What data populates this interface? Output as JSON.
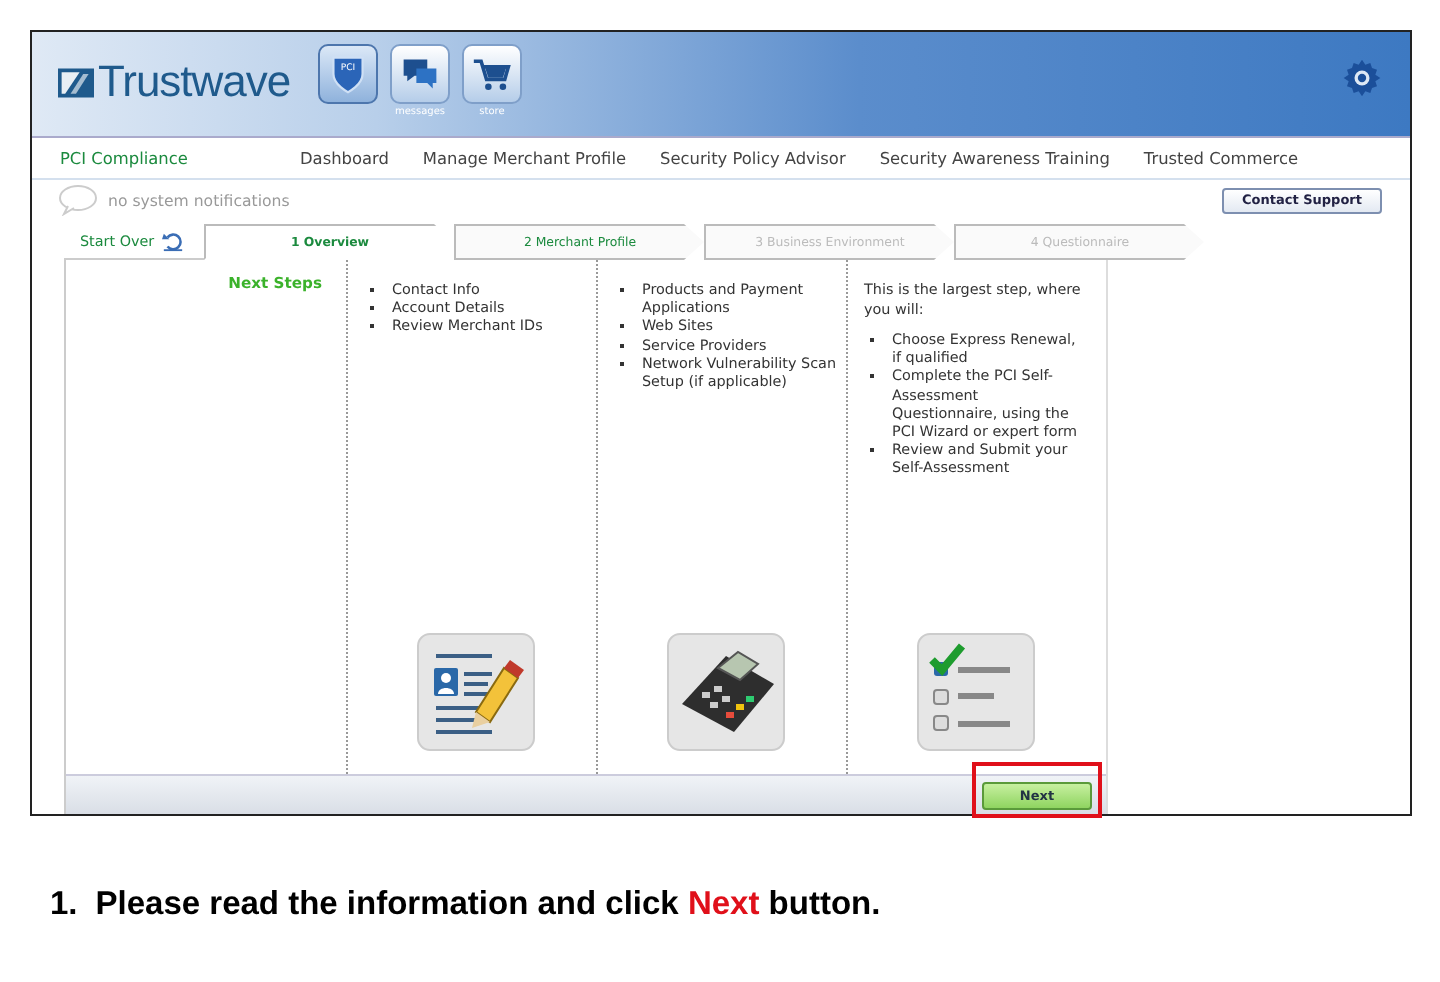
{
  "header": {
    "logo": "Trustwave",
    "apps": [
      {
        "kind": "pci",
        "badge": "PCI",
        "selected": true
      },
      {
        "kind": "messages",
        "label": "messages",
        "selected": false
      },
      {
        "kind": "store",
        "label": "store",
        "selected": false
      }
    ]
  },
  "nav": {
    "section": "PCI Compliance",
    "items": [
      "Dashboard",
      "Manage Merchant Profile",
      "Security Policy Advisor",
      "Security Awareness Training",
      "Trusted Commerce"
    ]
  },
  "notifications": "no system notifications",
  "contact_button": "Contact Support",
  "steps": {
    "start_over": "Start Over",
    "items": [
      {
        "label": "1 Overview",
        "selected": true,
        "disabled": false
      },
      {
        "label": "2 Merchant Profile",
        "selected": false,
        "disabled": false
      },
      {
        "label": "3 Business Environment",
        "selected": false,
        "disabled": true
      },
      {
        "label": "4 Questionnaire",
        "selected": false,
        "disabled": true
      }
    ]
  },
  "next_steps_title": "Next Steps",
  "columns": [
    {
      "kind": "profile",
      "items": [
        "Contact Info",
        "Account Details",
        "Review Merchant IDs"
      ]
    },
    {
      "kind": "terminal",
      "items": [
        "Products and Payment Applications",
        "Web Sites",
        "Service Providers",
        "Network Vulnerability Scan Setup (if applicable)"
      ]
    },
    {
      "kind": "checklist",
      "intro": "This is the largest step, where you will:",
      "items": [
        "Choose Express Renewal, if qualified",
        "Complete the PCI Self-Assessment Questionnaire, using the PCI Wizard or expert form",
        "Review and Submit your Self-Assessment"
      ]
    }
  ],
  "next_button": "Next",
  "caption": {
    "number": "1.",
    "parts": [
      {
        "text": "Please read the information and click ",
        "highlight": false
      },
      {
        "text": "Next",
        "highlight": true
      },
      {
        "text": " button.",
        "highlight": false
      }
    ]
  }
}
